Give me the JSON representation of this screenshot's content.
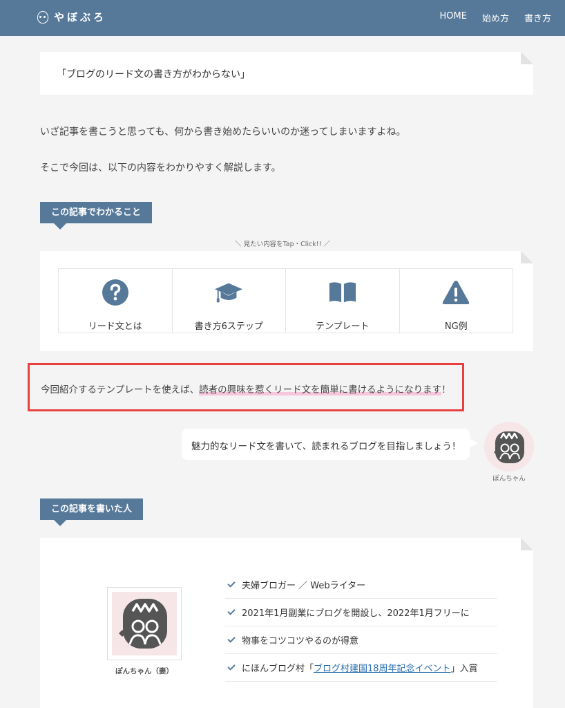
{
  "header": {
    "site_name": "やぼぶろ",
    "nav": [
      "HOME",
      "始め方",
      "書き方"
    ],
    "bg_color": "#56799a"
  },
  "intro": {
    "quote": "「ブログのリード文の書き方がわからない」",
    "para1": "いざ記事を書こうと思っても、何から書き始めたらいいのか迷ってしまいますよね。",
    "para2": "そこで今回は、以下の内容をわかりやすく解説します。"
  },
  "toc": {
    "heading": "この記事でわかること",
    "hint": "＼ 見たい内容をTap・Click!! ／",
    "items": [
      {
        "label": "リード文とは",
        "icon": "question-circle-icon"
      },
      {
        "label": "書き方6ステップ",
        "icon": "graduation-cap-icon"
      },
      {
        "label": "テンプレート",
        "icon": "open-book-icon"
      },
      {
        "label": "NG例",
        "icon": "warning-triangle-icon"
      }
    ]
  },
  "highlight": {
    "prefix": "今回紹介するテンプレートを使えば、",
    "marked": "読者の興味を惹くリード文を簡単に書けるようになります",
    "suffix": "！",
    "border_color": "#e8403f"
  },
  "speech": {
    "text": "魅力的なリード文を書いて、読まれるブログを目指しましょう！",
    "speaker": "ぽんちゃん"
  },
  "author": {
    "heading": "この記事を書いた人",
    "name": "ぽんちゃん（妻）",
    "facts": [
      "夫婦ブロガー ／ Webライター",
      "2021年1月副業にブログを開設し、2022年1月フリーに",
      "物事をコツコツやるのが得意"
    ],
    "award_prefix": "にほんブログ村「",
    "award_link": "ブログ村建国18周年記念イベント",
    "award_suffix": "」入賞"
  }
}
